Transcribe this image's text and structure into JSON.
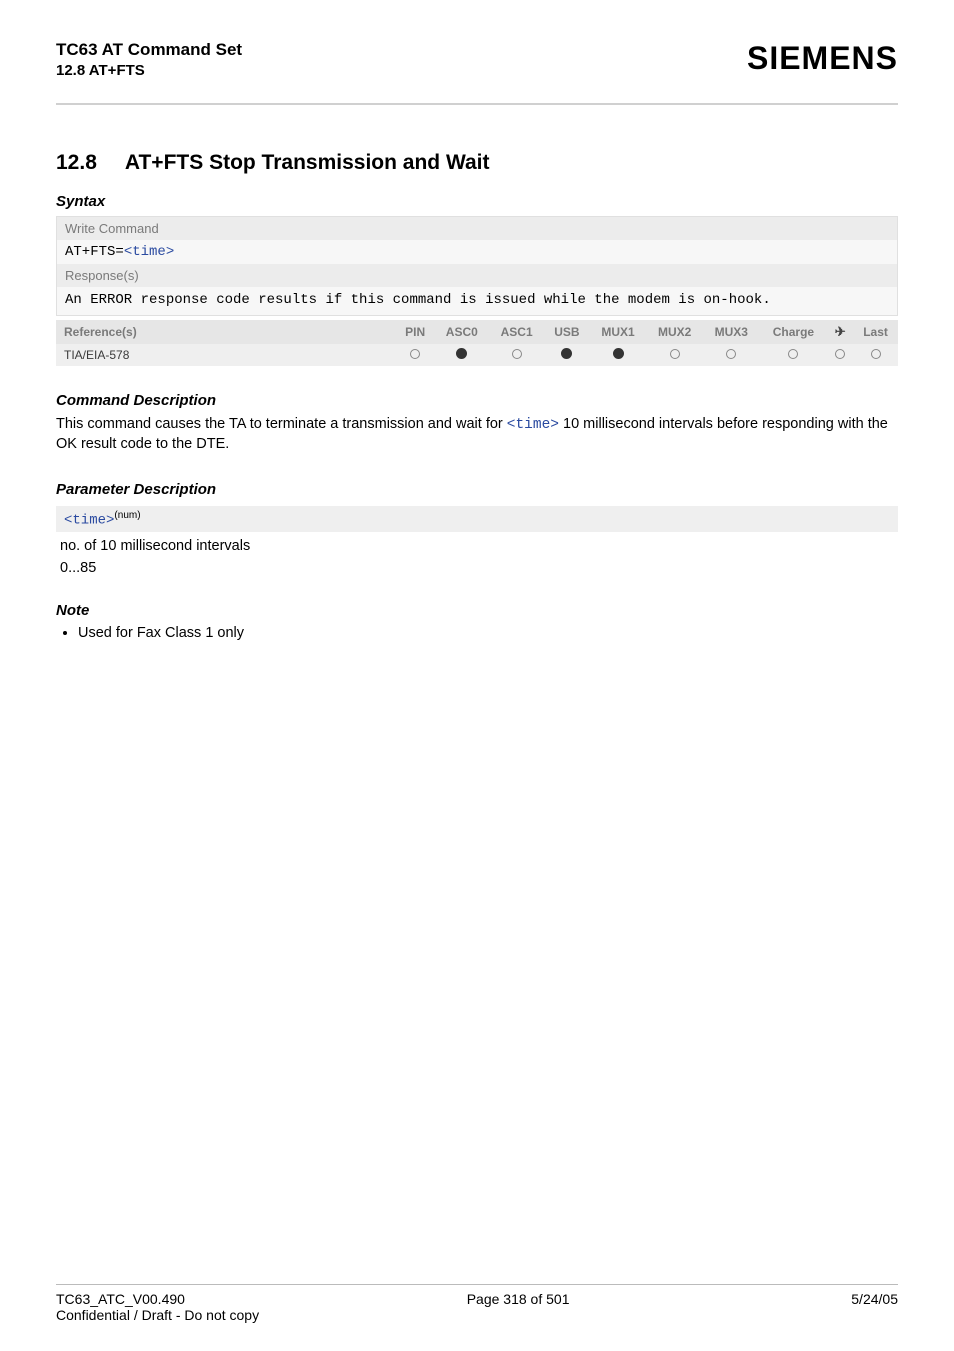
{
  "header": {
    "line1": "TC63 AT Command Set",
    "line2": "12.8 AT+FTS",
    "brand": "SIEMENS"
  },
  "section": {
    "number": "12.8",
    "title": "AT+FTS   Stop Transmission and Wait"
  },
  "syntax": {
    "label": "Syntax",
    "write_command_label": "Write Command",
    "write_command_code_prefix": "AT+FTS=",
    "write_command_code_param": "<time>",
    "responses_label": "Response(s)",
    "responses_text": "An ERROR response code results if this command is issued while the modem is on-hook."
  },
  "ref_table": {
    "headers": [
      "Reference(s)",
      "PIN",
      "ASC0",
      "ASC1",
      "USB",
      "MUX1",
      "MUX2",
      "MUX3",
      "Charge",
      "airplane",
      "Last"
    ],
    "reference_value": "TIA/EIA-578",
    "values": [
      "open",
      "filled",
      "open",
      "filled",
      "filled",
      "open",
      "open",
      "open",
      "open",
      "open"
    ]
  },
  "command_description": {
    "heading": "Command Description",
    "text_before": "This command causes the TA to terminate a transmission and wait for ",
    "inline_code": "<time>",
    "text_after": " 10 millisecond intervals before responding with the OK result code to the DTE."
  },
  "parameter_description": {
    "heading": "Parameter Description",
    "param_code": "<time>",
    "param_sup": "(num)",
    "desc1": "no. of 10 millisecond intervals",
    "desc2": "0...85"
  },
  "note": {
    "heading": "Note",
    "item": "Used for Fax Class 1 only"
  },
  "footer": {
    "left": "TC63_ATC_V00.490",
    "center": "Page 318 of 501",
    "right": "5/24/05",
    "sub": "Confidential / Draft - Do not copy"
  }
}
